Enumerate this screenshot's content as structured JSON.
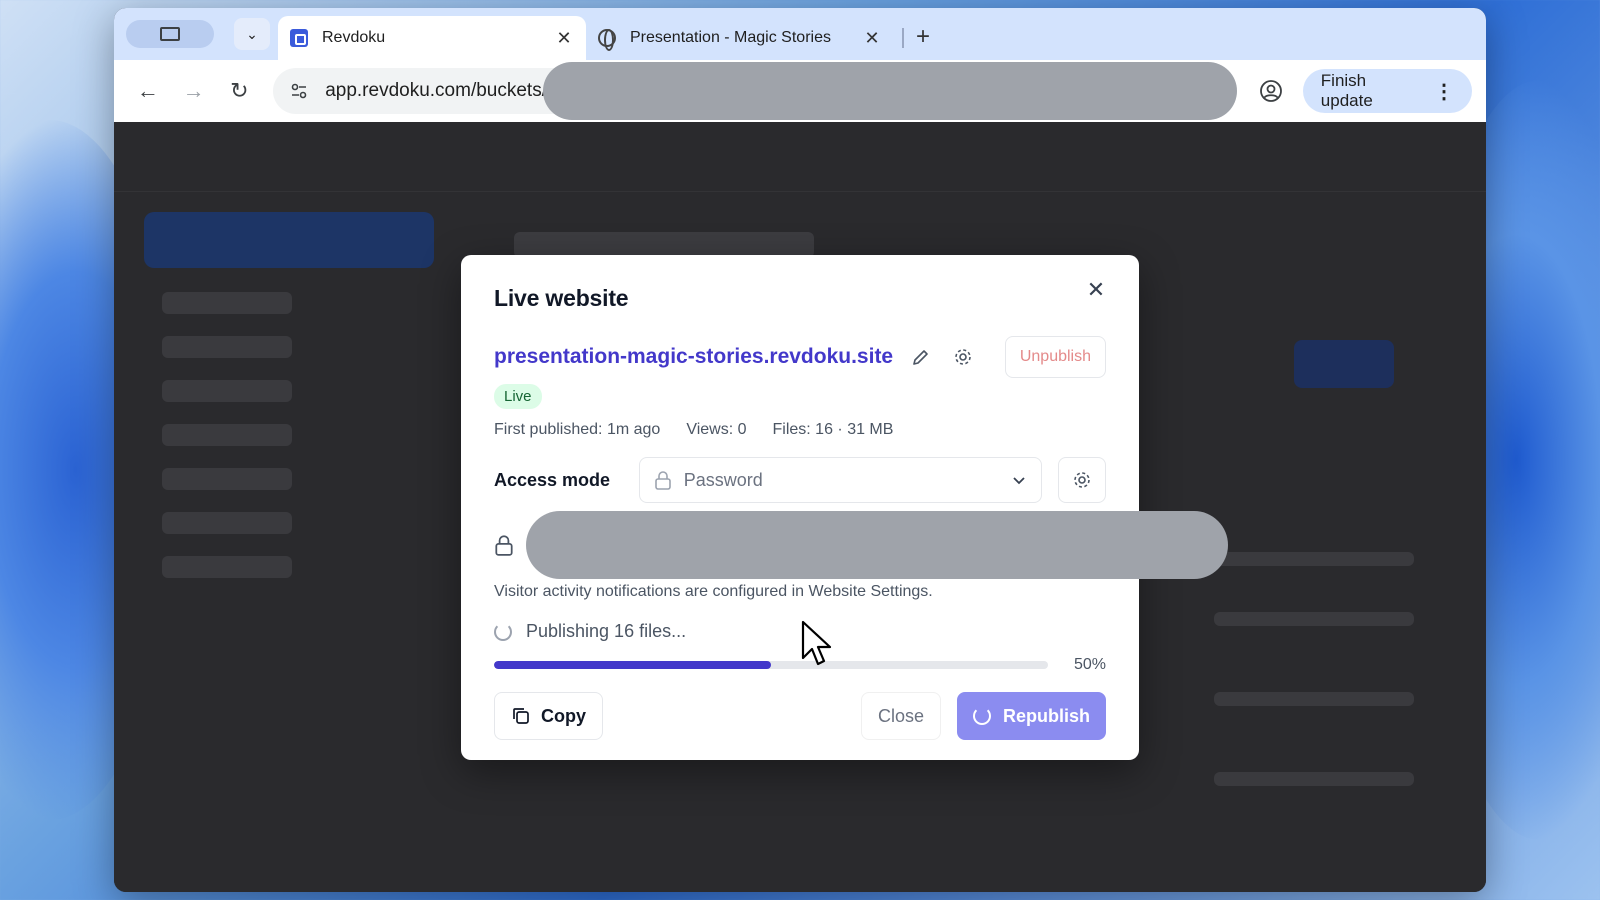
{
  "browser": {
    "tabs": [
      {
        "title": "Revdoku",
        "icon": "revdoku-doc-icon",
        "active": true
      },
      {
        "title": "Presentation - Magic Stories",
        "icon": "globe-icon",
        "active": false
      }
    ],
    "url": "app.revdoku.com/buckets/",
    "finish_update_label": "Finish update"
  },
  "modal": {
    "title": "Live website",
    "site_url": "presentation-magic-stories.revdoku.site",
    "unpublish_label": "Unpublish",
    "status_badge": "Live",
    "meta": {
      "first_published": "First published: 1m ago",
      "views": "Views: 0",
      "files": "Files: 16 · 31 MB"
    },
    "access_mode_label": "Access mode",
    "access_mode_value": "Password",
    "notification_text": "Visitor activity notifications are configured in Website Settings.",
    "publishing_text": "Publishing 16 files...",
    "progress_percent": 50,
    "progress_label": "50%",
    "copy_label": "Copy",
    "close_label": "Close",
    "republish_label": "Republish"
  },
  "colors": {
    "accent": "#4338ca",
    "republish_bg": "#8b8cf0",
    "live_badge_bg": "#dcfce7",
    "unpublish_text": "#e48a8a"
  }
}
